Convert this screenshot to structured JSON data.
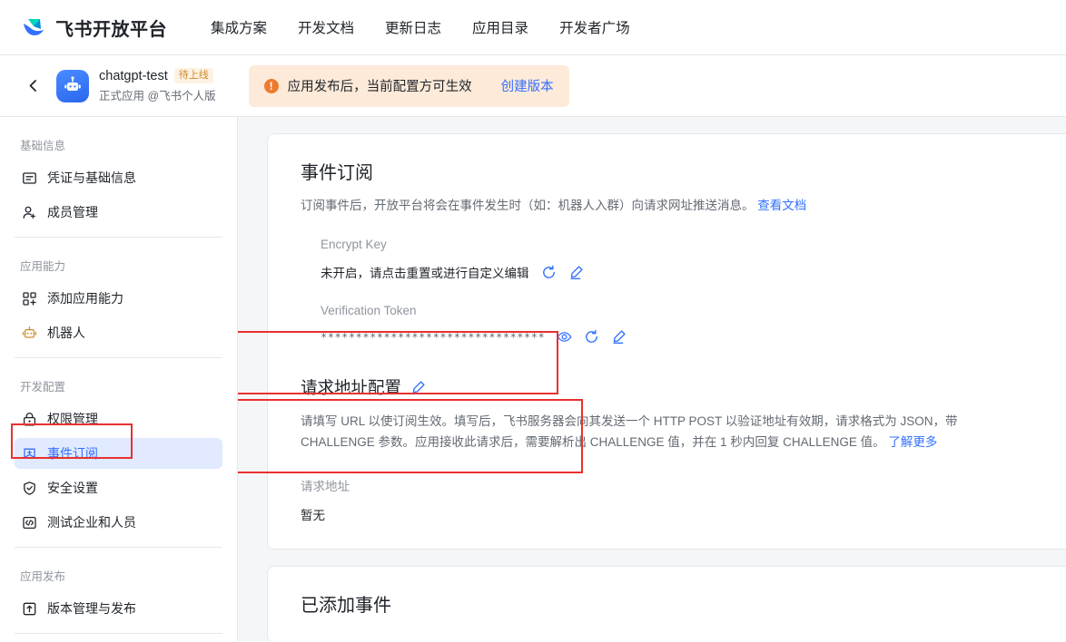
{
  "brand": {
    "logo_icon": "feishu-logo-icon",
    "name": "飞书开放平台"
  },
  "topnav": {
    "links": [
      {
        "label": "集成方案"
      },
      {
        "label": "开发文档"
      },
      {
        "label": "更新日志"
      },
      {
        "label": "应用目录"
      },
      {
        "label": "开发者广场"
      }
    ]
  },
  "appbar": {
    "back_icon": "chevron-left-icon",
    "avatar_icon": "robot-avatar-icon",
    "app_name": "chatgpt-test",
    "status_badge": "待上线",
    "app_subtitle": "正式应用 @飞书个人版",
    "alert": {
      "icon": "warning-exclamation-icon",
      "text": "应用发布后，当前配置方可生效",
      "action_label": "创建版本"
    }
  },
  "sidebar": {
    "groups": [
      {
        "title": "基础信息",
        "items": [
          {
            "label": "凭证与基础信息",
            "icon": "credential-card-icon",
            "active": false
          },
          {
            "label": "成员管理",
            "icon": "user-add-icon",
            "active": false
          }
        ]
      },
      {
        "title": "应用能力",
        "items": [
          {
            "label": "添加应用能力",
            "icon": "grid-add-icon",
            "active": false
          },
          {
            "label": "机器人",
            "icon": "robot-icon",
            "active": false
          }
        ]
      },
      {
        "title": "开发配置",
        "items": [
          {
            "label": "权限管理",
            "icon": "lock-icon",
            "active": false
          },
          {
            "label": "事件订阅",
            "icon": "event-bookmark-icon",
            "active": true
          },
          {
            "label": "安全设置",
            "icon": "shield-check-icon",
            "active": false
          },
          {
            "label": "测试企业和人员",
            "icon": "code-brackets-icon",
            "active": false
          }
        ]
      },
      {
        "title": "应用发布",
        "items": [
          {
            "label": "版本管理与发布",
            "icon": "upload-box-icon",
            "active": false
          }
        ]
      }
    ]
  },
  "main": {
    "event_subscription": {
      "title": "事件订阅",
      "description": "订阅事件后，开放平台将会在事件发生时（如：机器人入群）向请求网址推送消息。",
      "doc_link": "查看文档",
      "encrypt_key": {
        "label": "Encrypt Key",
        "value": "未开启，请点击重置或进行自定义编辑",
        "refresh_icon": "refresh-icon",
        "edit_icon": "pencil-edit-icon"
      },
      "verification_token": {
        "label": "Verification Token",
        "value": "********************************",
        "eye_icon": "eye-icon",
        "refresh_icon": "refresh-icon",
        "edit_icon": "pencil-edit-icon"
      },
      "request_url": {
        "title": "请求地址配置",
        "edit_icon": "pencil-edit-icon",
        "description": "请填写 URL 以使订阅生效。填写后，飞书服务器会向其发送一个 HTTP POST 以验证地址有效期，请求格式为 JSON，带 CHALLENGE 参数。应用接收此请求后，需要解析出 CHALLENGE 值，并在 1 秒内回复 CHALLENGE 值。",
        "more_link": "了解更多",
        "field_label": "请求地址",
        "field_value": "暂无"
      }
    },
    "added_events": {
      "title": "已添加事件"
    }
  },
  "colors": {
    "accent": "#3370ff",
    "highlight": "#e8312f",
    "warning": "#ed7b2f",
    "badge_text": "#d2892c",
    "page_bg": "#f5f6f7"
  }
}
